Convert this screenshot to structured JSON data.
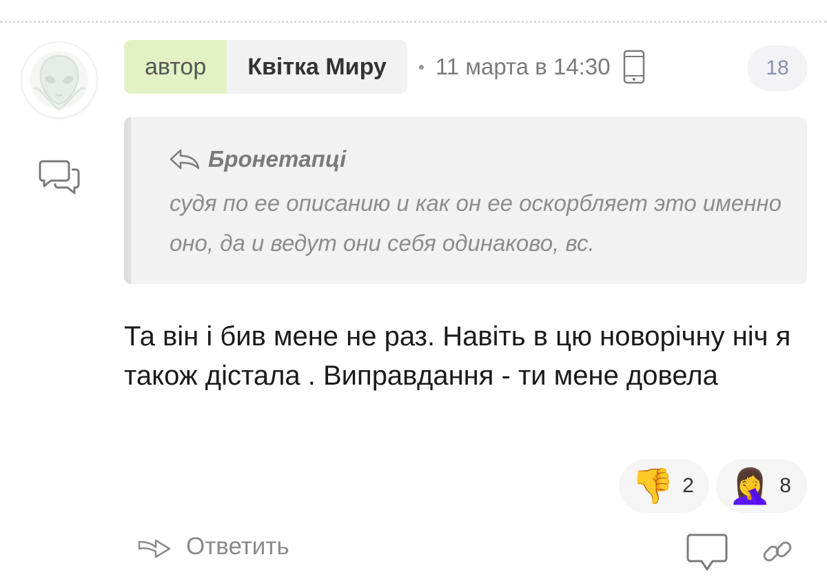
{
  "comment": {
    "author_label": "автор",
    "author_name": "Квітка Миру",
    "separator": "•",
    "timestamp": "11 марта в 14:30",
    "rating": "18",
    "quote": {
      "author": "Бронетапці",
      "text": "судя по ее описанию и как он ее оскорбляет это именно оно, да и ведут они себя одинаково, вс."
    },
    "body": "Та він і бив мене не раз. Навіть в цю новорічну ніч я також дістала . Виправдання - ти мене довела",
    "reactions": [
      {
        "emoji": "👎",
        "icon": "thumbs-down-icon",
        "count": "2"
      },
      {
        "emoji": "🤦‍♀️",
        "icon": "facepalm-icon",
        "count": "8"
      }
    ],
    "reply_label": "Ответить"
  },
  "icons": [
    "avatar-alien-icon",
    "comments-icon",
    "phone-icon",
    "reply-arrow-icon",
    "comment-bubble-icon",
    "link-icon"
  ],
  "colors": {
    "author_label_bg": "#e3f2c4",
    "author_name_bg": "#f2f2f2",
    "quote_bg": "#f2f2f2",
    "badge_text": "#8a8fb0"
  }
}
